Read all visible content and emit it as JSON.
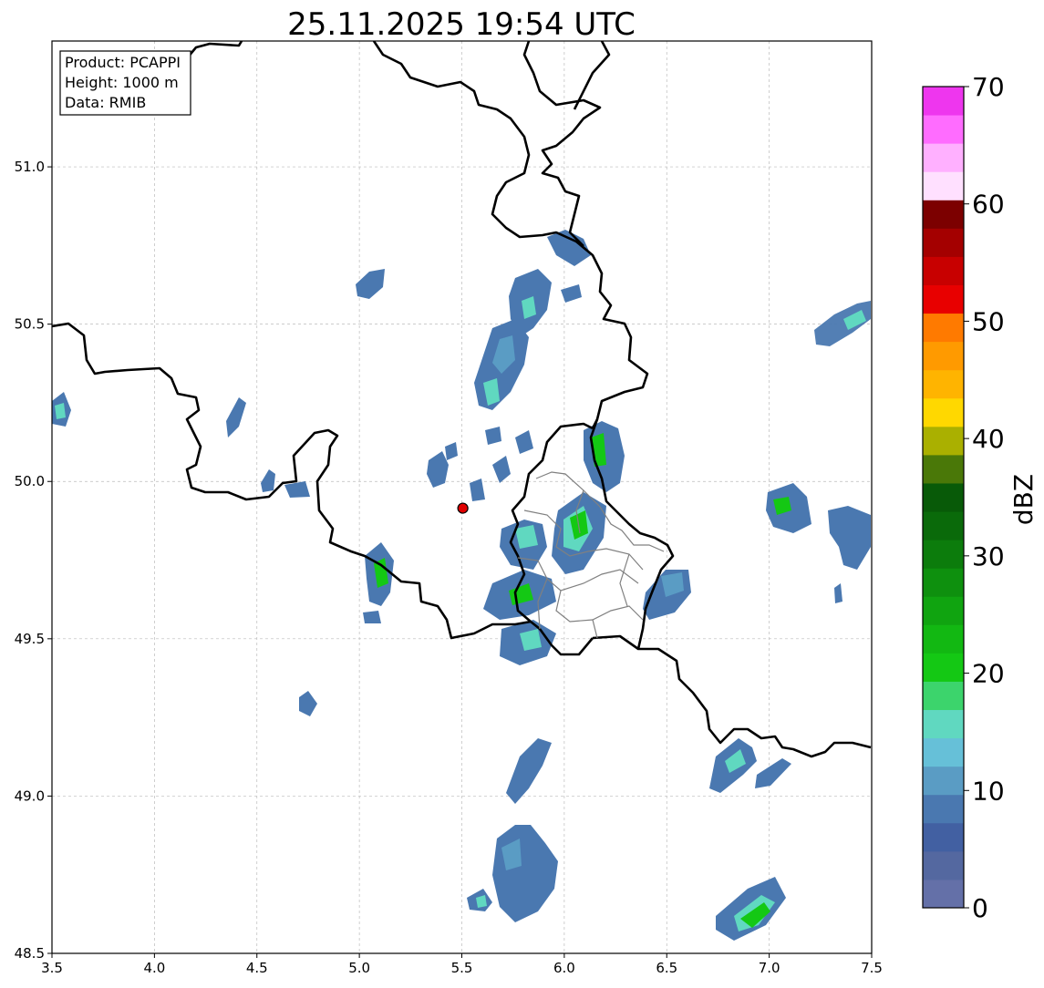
{
  "title": "25.11.2025 19:54 UTC",
  "info_box": [
    "Product: PCAPPI",
    "Height: 1000 m",
    "Data: RMIB"
  ],
  "map": {
    "x_ticks": [
      "3.5",
      "4.0",
      "4.5",
      "5.0",
      "5.5",
      "6.0",
      "6.5",
      "7.0",
      "7.5"
    ],
    "y_ticks": [
      "48.5",
      "49.0",
      "49.5",
      "50.0",
      "50.5",
      "51.0"
    ],
    "lon_range": [
      3.5,
      7.5
    ],
    "lat_range": [
      48.5,
      51.4
    ],
    "grid": true,
    "radar_site": {
      "lon": 5.505,
      "lat": 49.915,
      "color": "#e00000"
    }
  },
  "colorbar": {
    "label": "dBZ",
    "ticks": [
      "0",
      "10",
      "20",
      "30",
      "40",
      "50",
      "60",
      "70"
    ],
    "range": [
      0,
      70
    ],
    "colors": [
      "#6470a8",
      "#5468a0",
      "#4260a2",
      "#4a78b0",
      "#5a9cc4",
      "#66c0d8",
      "#60d8c0",
      "#3cd46c",
      "#14c814",
      "#12b812",
      "#10a410",
      "#0e900e",
      "#0c7c0c",
      "#0a6a0a",
      "#085a08",
      "#4a7808",
      "#aab000",
      "#ffd800",
      "#ffb400",
      "#ff9a00",
      "#ff7a00",
      "#e80000",
      "#c80000",
      "#a40000",
      "#7c0000",
      "#ffe0ff",
      "#ffb0ff",
      "#ff6cff",
      "#ee36ee"
    ]
  },
  "echo_colors": {
    "light": "#4a78b0",
    "mid": "#5a9cc4",
    "cyan": "#60d8c0",
    "green": "#14c814"
  }
}
